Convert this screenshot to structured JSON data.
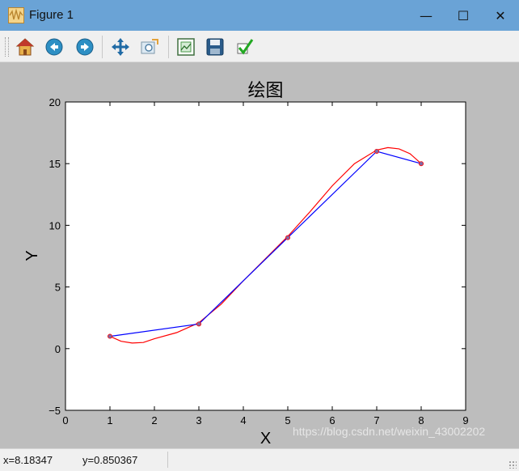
{
  "window": {
    "title": "Figure 1"
  },
  "window_controls": {
    "minimize": "—",
    "maximize": "☐",
    "close": "✕"
  },
  "toolbar": {
    "items": [
      {
        "name": "home-button",
        "icon": "home-icon"
      },
      {
        "name": "back-button",
        "icon": "arrow-left-icon"
      },
      {
        "name": "forward-button",
        "icon": "arrow-right-icon"
      },
      {
        "name": "pan-button",
        "icon": "move-icon"
      },
      {
        "name": "zoom-button",
        "icon": "zoom-rect-icon"
      },
      {
        "name": "subplots-button",
        "icon": "subplots-icon"
      },
      {
        "name": "save-button",
        "icon": "save-icon"
      },
      {
        "name": "edit-button",
        "icon": "check-icon"
      }
    ]
  },
  "status": {
    "x": "x=8.18347",
    "y": "y=0.850367"
  },
  "watermark": "https://blog.csdn.net/weixin_43002202",
  "colors": {
    "line": "#0000ff",
    "curve": "#ff0000",
    "marker": "#7f6aa6",
    "titlebar": "#6aa3d6",
    "figure_bg": "#bdbdbd"
  },
  "chart_data": {
    "type": "line",
    "title": "绘图",
    "xlabel": "X",
    "ylabel": "Y",
    "xlim": [
      0,
      9
    ],
    "ylim": [
      -5,
      20
    ],
    "xticks": [
      "0",
      "1",
      "2",
      "3",
      "4",
      "5",
      "6",
      "7",
      "8",
      "9"
    ],
    "yticks": [
      "−5",
      "0",
      "5",
      "10",
      "15",
      "20"
    ],
    "grid": false,
    "series": [
      {
        "style": "line+markers",
        "x": [
          1,
          3,
          5,
          7,
          8
        ],
        "y": [
          1,
          2,
          9,
          16,
          15
        ]
      },
      {
        "style": "smooth-curve",
        "x": [
          1,
          1.25,
          1.5,
          1.75,
          2,
          2.5,
          3,
          3.5,
          4,
          4.5,
          5,
          5.5,
          6,
          6.5,
          7,
          7.25,
          7.5,
          7.75,
          8
        ],
        "y": [
          1,
          0.6,
          0.45,
          0.5,
          0.8,
          1.3,
          2.1,
          3.6,
          5.5,
          7.3,
          9.1,
          11.1,
          13.2,
          15.0,
          16.1,
          16.3,
          16.2,
          15.8,
          15.0
        ]
      }
    ]
  }
}
